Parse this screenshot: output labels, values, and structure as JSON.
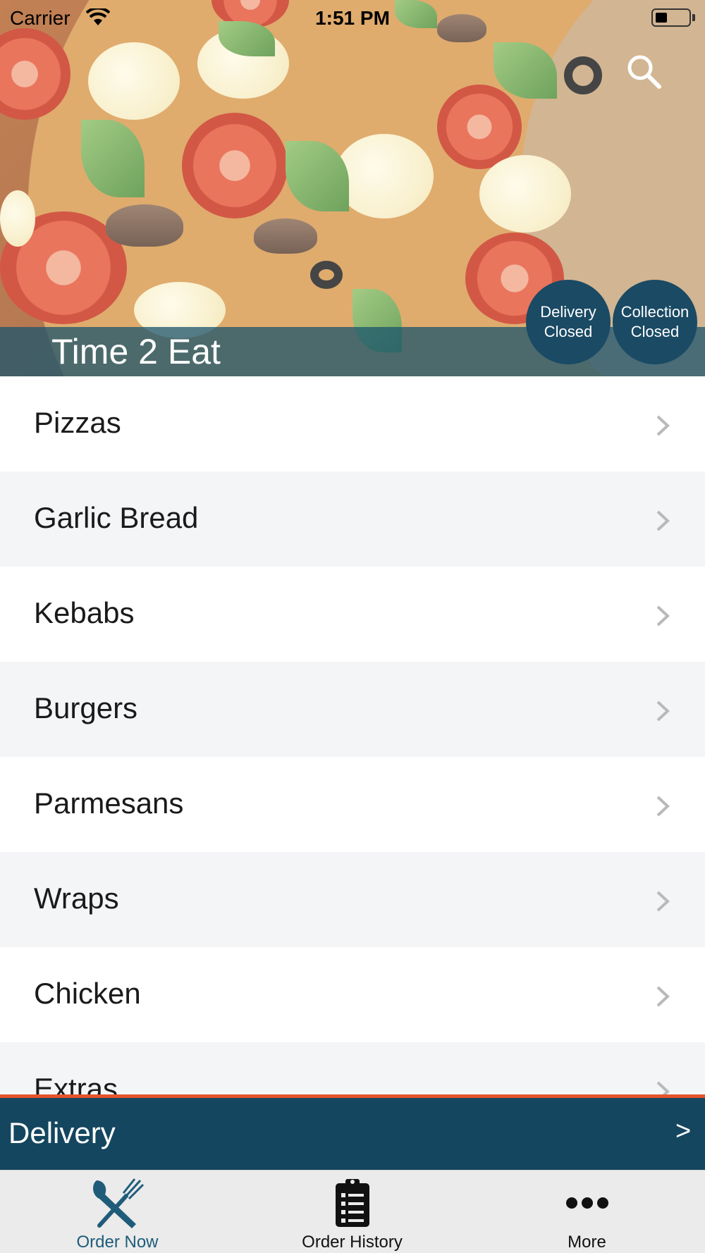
{
  "status_bar": {
    "carrier": "Carrier",
    "time": "1:51 PM"
  },
  "header": {
    "restaurant_name": "Time 2 Eat",
    "delivery_status": {
      "line1": "Delivery",
      "line2": "Closed"
    },
    "collection_status": {
      "line1": "Collection",
      "line2": "Closed"
    },
    "search_icon": "search-icon"
  },
  "menu": {
    "items": [
      {
        "label": "Pizzas"
      },
      {
        "label": "Garlic Bread"
      },
      {
        "label": "Kebabs"
      },
      {
        "label": "Burgers"
      },
      {
        "label": "Parmesans"
      },
      {
        "label": "Wraps"
      },
      {
        "label": "Chicken"
      },
      {
        "label": "Extras"
      }
    ]
  },
  "order_bar": {
    "mode": "Delivery",
    "arrow": ">"
  },
  "tabs": [
    {
      "label": "Order Now",
      "icon": "fork-knife-icon",
      "active": true
    },
    {
      "label": "Order History",
      "icon": "clipboard-list-icon",
      "active": false
    },
    {
      "label": "More",
      "icon": "more-dots-icon",
      "active": false
    }
  ],
  "colors": {
    "primary": "#14465f",
    "accent": "#e5532b",
    "active_tab": "#1f5c7a",
    "row_alt": "#f4f5f7"
  }
}
